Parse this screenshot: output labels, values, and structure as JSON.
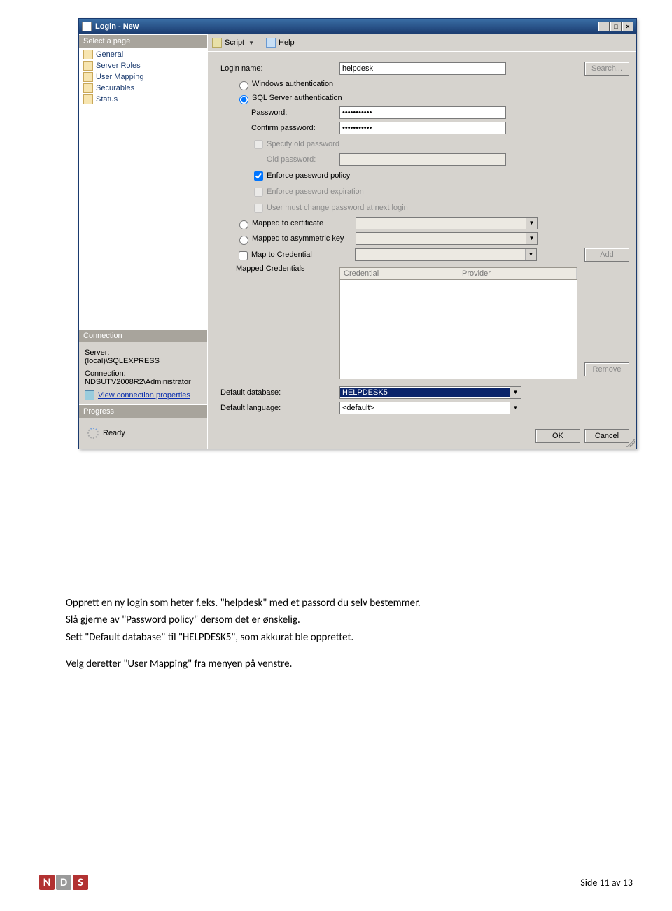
{
  "window": {
    "title": "Login - New",
    "winbtns": {
      "min": "_",
      "max": "□",
      "close": "×"
    }
  },
  "sidebar": {
    "select_header": "Select a page",
    "pages": [
      {
        "label": "General"
      },
      {
        "label": "Server Roles"
      },
      {
        "label": "User Mapping"
      },
      {
        "label": "Securables"
      },
      {
        "label": "Status"
      }
    ],
    "connection_header": "Connection",
    "server_label": "Server:",
    "server_value": "(local)\\SQLEXPRESS",
    "connection_label": "Connection:",
    "connection_value": "NDSUTV2008R2\\Administrator",
    "view_conn_link": "View connection properties",
    "progress_header": "Progress",
    "progress_status": "Ready"
  },
  "toolbar": {
    "script": "Script",
    "help": "Help"
  },
  "form": {
    "login_name_label": "Login name:",
    "login_name_value": "helpdesk",
    "search_btn": "Search...",
    "radio_win": "Windows authentication",
    "radio_sql": "SQL Server authentication",
    "password_label": "Password:",
    "password_value": "•••••••••••",
    "confirm_label": "Confirm password:",
    "confirm_value": "•••••••••••",
    "specify_old": "Specify old password",
    "old_pw_label": "Old password:",
    "enforce_policy": "Enforce password policy",
    "enforce_expiration": "Enforce password expiration",
    "must_change": "User must change password at next login",
    "mapped_cert": "Mapped to certificate",
    "mapped_asym": "Mapped to asymmetric key",
    "map_cred": "Map to Credential",
    "add_btn": "Add",
    "mapped_creds_label": "Mapped Credentials",
    "cred_col1": "Credential",
    "cred_col2": "Provider",
    "remove_btn": "Remove",
    "default_db_label": "Default database:",
    "default_db_value": "HELPDESK5",
    "default_lang_label": "Default language:",
    "default_lang_value": "<default>"
  },
  "buttons": {
    "ok": "OK",
    "cancel": "Cancel"
  },
  "doc": {
    "p1": "Opprett en ny login som heter f.eks. \"helpdesk\" med et passord du selv bestemmer.",
    "p2": "Slå gjerne av \"Password policy\" dersom det er ønskelig.",
    "p3": "Sett \"Default database\" til \"HELPDESK5\", som akkurat ble opprettet.",
    "p4": "Velg deretter \"User Mapping\" fra menyen på venstre."
  },
  "footer": {
    "page": "Side 11 av 13",
    "logo": [
      "N",
      "D",
      "S"
    ]
  }
}
